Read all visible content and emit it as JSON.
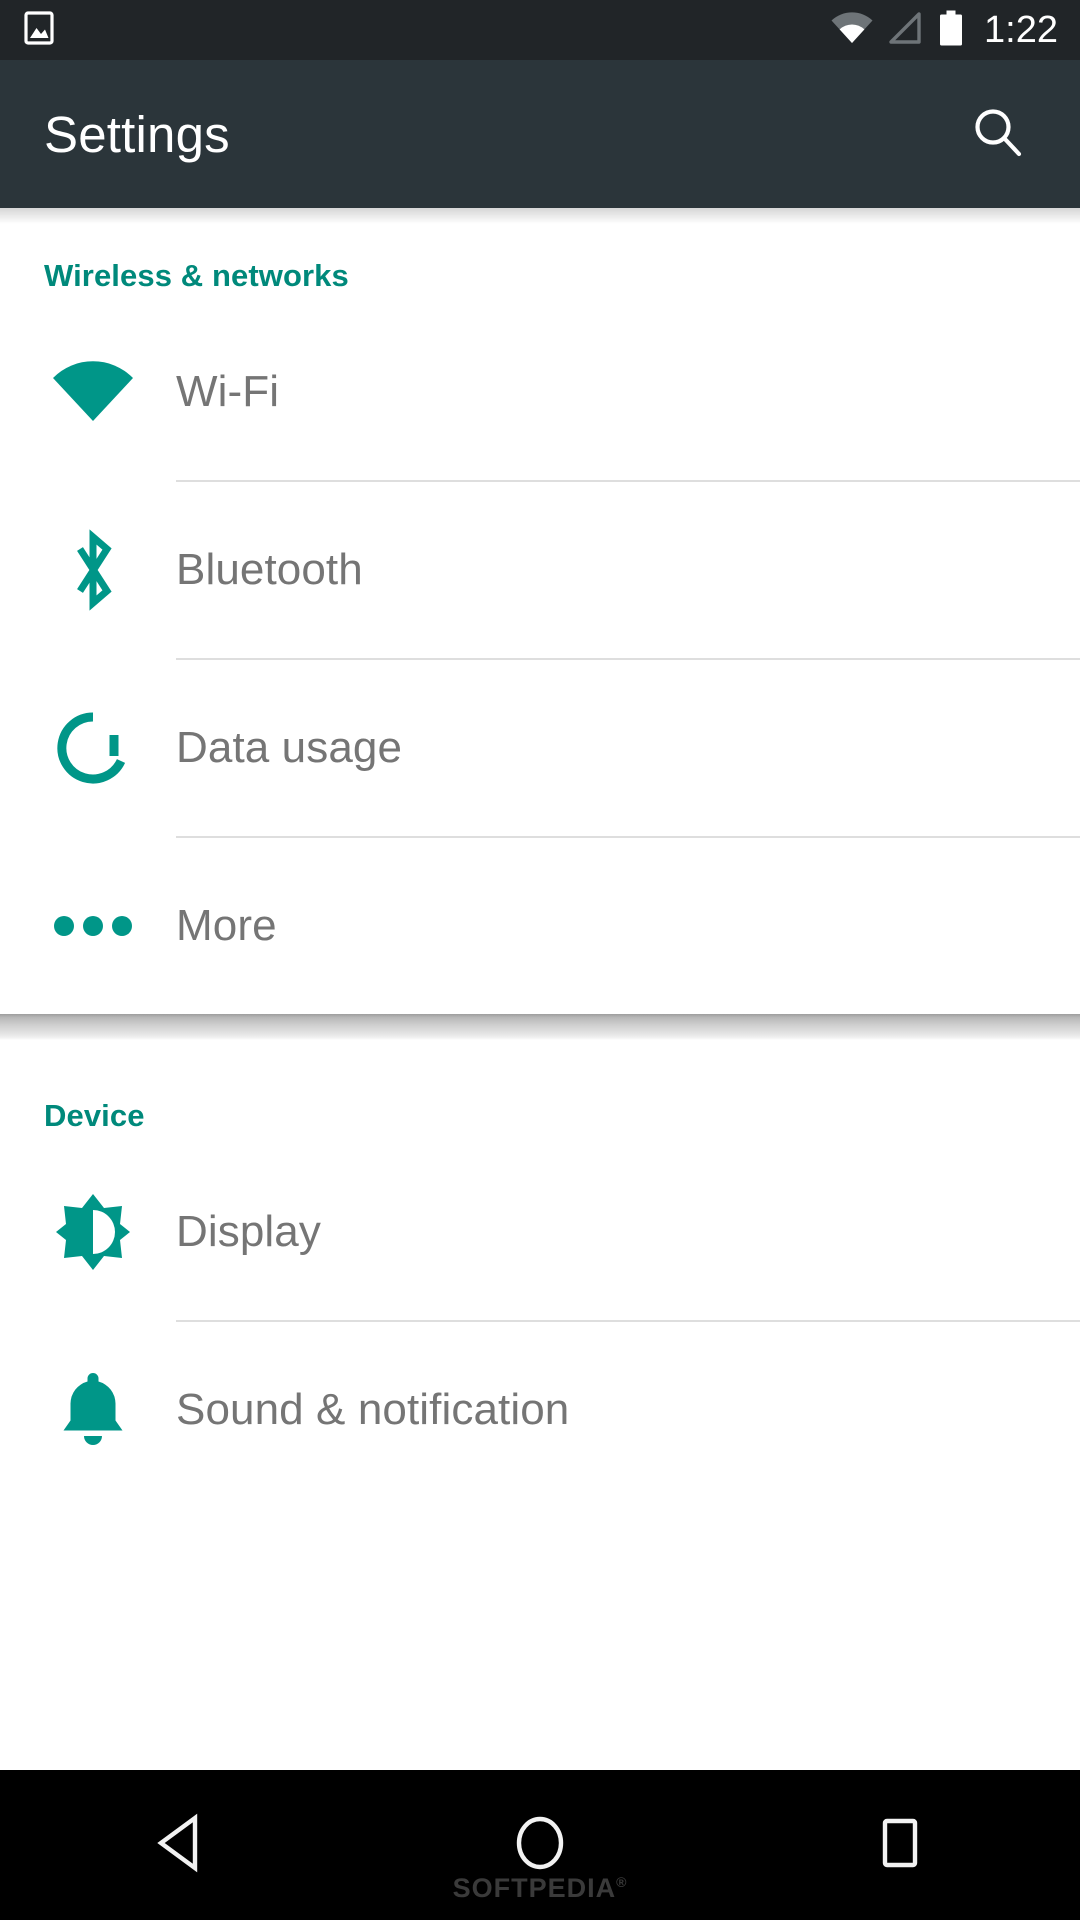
{
  "status_bar": {
    "time": "1:22",
    "icons": {
      "notification": "image-icon",
      "wifi": "wifi-signal-icon",
      "cellular": "cell-signal-icon",
      "battery": "battery-full-icon"
    },
    "background_color": "#212528"
  },
  "app_bar": {
    "title": "Settings",
    "search_label": "Search",
    "search_icon": "search-icon",
    "background_color": "#2b353a",
    "title_color": "#ffffff"
  },
  "theme": {
    "accent": "#00897b",
    "icon_teal": "#009688",
    "row_label": "#757575",
    "divider": "#dedede",
    "page_background": "#ffffff"
  },
  "sections": [
    {
      "header": "Wireless & networks",
      "items": [
        {
          "label": "Wi-Fi",
          "icon": "wifi-icon"
        },
        {
          "label": "Bluetooth",
          "icon": "bluetooth-icon"
        },
        {
          "label": "Data usage",
          "icon": "data-usage-icon"
        },
        {
          "label": "More",
          "icon": "more-dots-icon"
        }
      ]
    },
    {
      "header": "Device",
      "items": [
        {
          "label": "Display",
          "icon": "brightness-icon"
        },
        {
          "label": "Sound & notification",
          "icon": "bell-icon"
        }
      ]
    }
  ],
  "nav_bar": {
    "back_label": "Back",
    "home_label": "Home",
    "recents_label": "Recent apps",
    "back_icon": "triangle-back-icon",
    "home_icon": "circle-home-icon",
    "recents_icon": "square-recents-icon",
    "background_color": "#000000"
  },
  "watermark": {
    "text": "SOFTPEDIA",
    "symbol": "®"
  }
}
